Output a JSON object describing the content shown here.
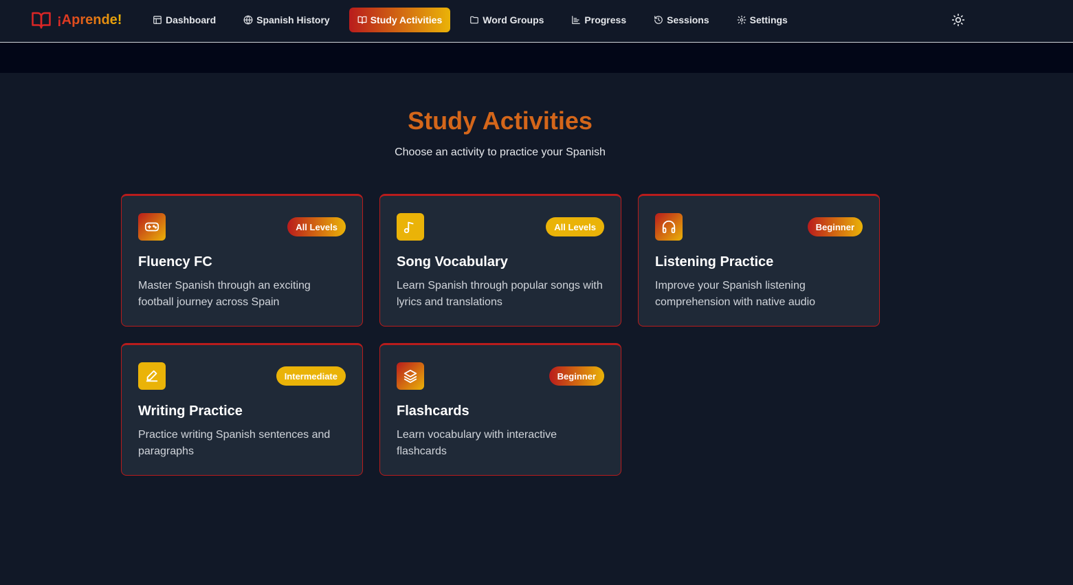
{
  "brand": {
    "name": "¡Aprende!"
  },
  "nav": {
    "items": [
      {
        "label": "Dashboard",
        "icon": "layout-icon",
        "active": false
      },
      {
        "label": "Spanish History",
        "icon": "globe-icon",
        "active": false
      },
      {
        "label": "Study Activities",
        "icon": "book-icon",
        "active": true
      },
      {
        "label": "Word Groups",
        "icon": "folder-icon",
        "active": false
      },
      {
        "label": "Progress",
        "icon": "chart-icon",
        "active": false
      },
      {
        "label": "Sessions",
        "icon": "history-icon",
        "active": false
      },
      {
        "label": "Settings",
        "icon": "gear-icon",
        "active": false
      }
    ],
    "theme_toggle_icon": "sun-icon"
  },
  "header": {
    "title": "Study Activities",
    "subtitle": "Choose an activity to practice your Spanish"
  },
  "activities": [
    {
      "title": "Fluency FC",
      "description": "Master Spanish through an exciting football journey across Spain",
      "level": "All Levels",
      "icon": "gamepad-icon",
      "style": "red"
    },
    {
      "title": "Song Vocabulary",
      "description": "Learn Spanish through popular songs with lyrics and translations",
      "level": "All Levels",
      "icon": "music-note-icon",
      "style": "yellow"
    },
    {
      "title": "Listening Practice",
      "description": "Improve your Spanish listening comprehension with native audio",
      "level": "Beginner",
      "icon": "headphones-icon",
      "style": "red"
    },
    {
      "title": "Writing Practice",
      "description": "Practice writing Spanish sentences and paragraphs",
      "level": "Intermediate",
      "icon": "pencil-icon",
      "style": "yellow"
    },
    {
      "title": "Flashcards",
      "description": "Learn vocabulary with interactive flashcards",
      "level": "Beginner",
      "icon": "layers-icon",
      "style": "red"
    }
  ],
  "colors": {
    "background": "#111827",
    "card": "#1f2937",
    "accent_red": "#b91c1c",
    "accent_yellow": "#eab308",
    "title_orange": "#d4661a"
  }
}
